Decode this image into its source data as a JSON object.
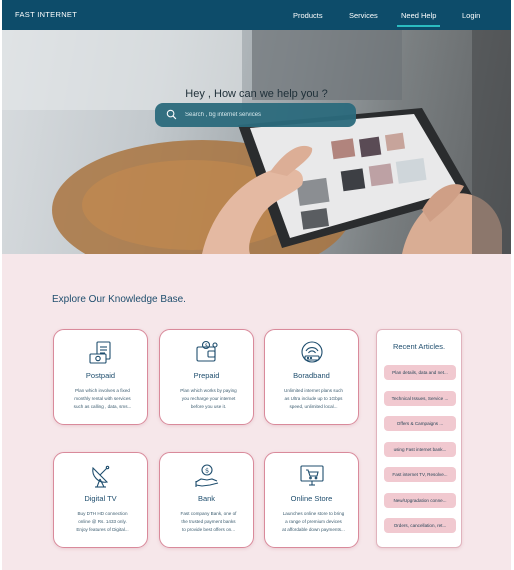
{
  "nav": {
    "brand": "FAST INTERNET",
    "links": [
      "Products",
      "Services",
      "Need Help",
      "Login"
    ],
    "active": "Need Help"
  },
  "hero": {
    "title": "Hey , How can we help you ?",
    "search_placeholder": "Search , bg internet services"
  },
  "kb": {
    "title": "Explore Our Knowledge Base.",
    "cards": [
      {
        "title": "Postpaid",
        "icon": "postpaid-bill-icon",
        "desc": [
          "Plan which involves a fixed",
          "monthly rental with services",
          "such as calling , data, sms..."
        ]
      },
      {
        "title": "Prepaid",
        "icon": "prepaid-wallet-icon",
        "desc": [
          "Plan which works by paying",
          "you recharge your internet",
          "before you use it."
        ]
      },
      {
        "title": "Boradband",
        "icon": "broadband-router-icon",
        "desc": [
          "Unlimited internet plans such",
          "as Ultra include up to 1Gbps",
          "speed, unlimited local..."
        ]
      },
      {
        "title": "Digital TV",
        "icon": "satellite-dish-icon",
        "desc": [
          "Buy DTH HD connection",
          "online @ Rs. 1433 only.",
          "Enjoy features of Digital..."
        ]
      },
      {
        "title": "Bank",
        "icon": "bank-hand-coin-icon",
        "desc": [
          "Fast company Bank, one of",
          "the trusted payment banks",
          "to provide best offers on..."
        ]
      },
      {
        "title": "Online Store",
        "icon": "online-store-cart-icon",
        "desc": [
          "Launches online store to bring",
          "a range of premium devices",
          "at affordable down payments..."
        ]
      }
    ],
    "recent": {
      "title": "Recent Articles.",
      "items": [
        "Plan details, data and net...",
        "Technical Issues, Service ...",
        "Offers & Campaigns ...",
        "using Fast internet bank...",
        "Fast internet TV, Resolve...",
        "New/Upgradation conne...",
        "Orders, cancellation, ret..."
      ]
    }
  }
}
